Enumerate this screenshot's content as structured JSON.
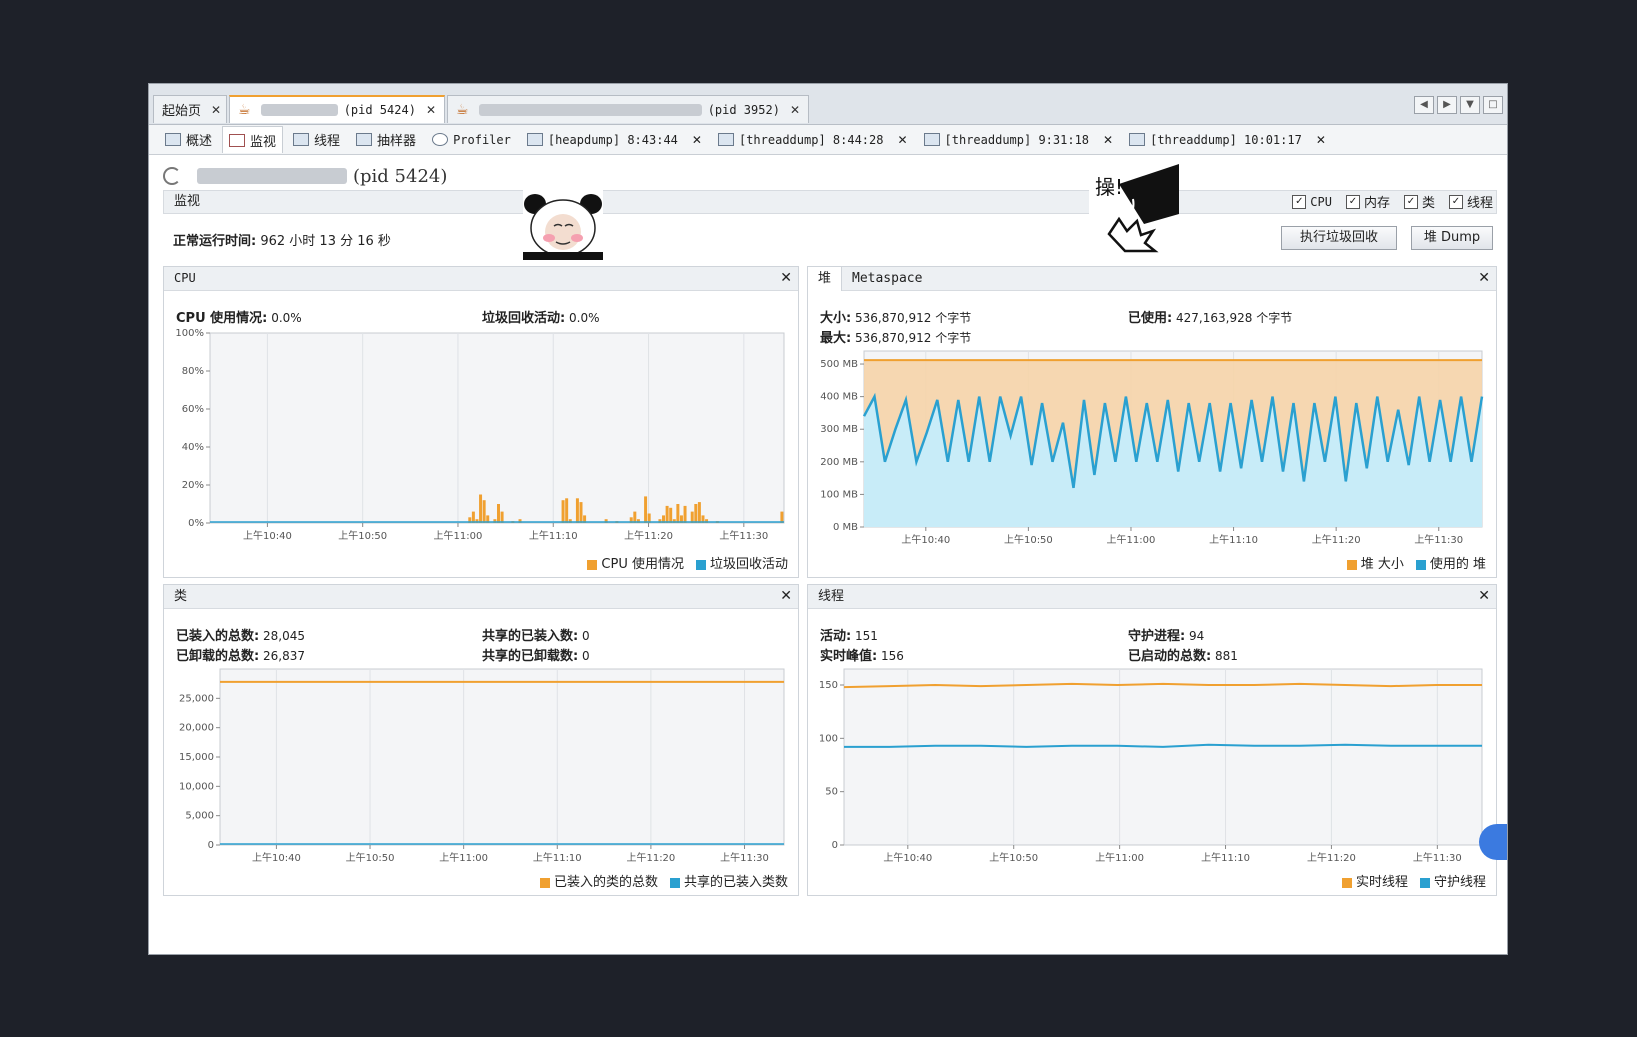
{
  "doc_tabs": [
    {
      "label": "起始页"
    },
    {
      "label": "(pid 5424)"
    },
    {
      "label": "(pid 3952)"
    }
  ],
  "sub_tabs": [
    {
      "label": "概述"
    },
    {
      "label": "监视"
    },
    {
      "label": "线程"
    },
    {
      "label": "抽样器"
    },
    {
      "label": "Profiler"
    },
    {
      "label": "[heapdump] 8:43:44"
    },
    {
      "label": "[threaddump] 8:44:28"
    },
    {
      "label": "[threaddump] 9:31:18"
    },
    {
      "label": "[threaddump] 10:01:17"
    }
  ],
  "process_title": "(pid 5424)",
  "monitor": {
    "section": "监视",
    "checkboxes": [
      "CPU",
      "内存",
      "类",
      "线程"
    ],
    "uptime_label": "正常运行时间:",
    "uptime_value": "962 小时 13 分 16 秒",
    "gc_button": "执行垃圾回收",
    "dump_button": "堆 Dump"
  },
  "stickers": {
    "text": "操!"
  },
  "cpu_panel": {
    "title": "CPU",
    "usage_label": "CPU 使用情况:",
    "usage_value": "0.0%",
    "gc_label": "垃圾回收活动:",
    "gc_value": "0.0%",
    "legend": [
      "CPU 使用情况",
      "垃圾回收活动"
    ]
  },
  "heap_panel": {
    "tabs": [
      "堆",
      "Metaspace"
    ],
    "size_label": "大小:",
    "size_value": "536,870,912 个字节",
    "max_label": "最大:",
    "max_value": "536,870,912 个字节",
    "used_label": "已使用:",
    "used_value": "427,163,928 个字节",
    "legend": [
      "堆 大小",
      "使用的 堆"
    ]
  },
  "classes_panel": {
    "title": "类",
    "loaded_label": "已装入的总数:",
    "loaded_value": "28,045",
    "unloaded_label": "已卸载的总数:",
    "unloaded_value": "26,837",
    "shared_loaded_label": "共享的已装入数:",
    "shared_loaded_value": "0",
    "shared_unloaded_label": "共享的已卸载数:",
    "shared_unloaded_value": "0",
    "legend": [
      "已装入的类的总数",
      "共享的已装入类数"
    ]
  },
  "threads_panel": {
    "title": "线程",
    "live_label": "活动:",
    "live_value": "151",
    "peak_label": "实时峰值:",
    "peak_value": "156",
    "daemon_label": "守护进程:",
    "daemon_value": "94",
    "started_label": "已启动的总数:",
    "started_value": "881",
    "legend": [
      "实时线程",
      "守护线程"
    ]
  },
  "colors": {
    "orange": "#f0a030",
    "blue": "#2aa0d0",
    "heap_fill": "#f6d4a8",
    "used_fill": "#c8ecf8"
  },
  "chart_data": [
    {
      "type": "bar",
      "title": "CPU",
      "x_ticks": [
        "上午10:40",
        "上午10:50",
        "上午11:00",
        "上午11:10",
        "上午11:20",
        "上午11:30"
      ],
      "y_ticks": [
        "100%",
        "80%",
        "60%",
        "40%",
        "20%",
        "0%"
      ],
      "ylim": [
        0,
        100
      ],
      "series": [
        {
          "name": "CPU 使用情况",
          "color": "#f0a030",
          "values": [
            0,
            0,
            0,
            0,
            0,
            0,
            0,
            0,
            0,
            0,
            0,
            0,
            0,
            0,
            0,
            0,
            0,
            0,
            0,
            0,
            0,
            0,
            0,
            0,
            0,
            0,
            0,
            0,
            0,
            0,
            0,
            0,
            0,
            0,
            0,
            0,
            0,
            0,
            0,
            0,
            0,
            0,
            0,
            0,
            0,
            0,
            0,
            0,
            0,
            0,
            0,
            0,
            0,
            0,
            0,
            0,
            0,
            0,
            0,
            0,
            0,
            0,
            0,
            0,
            0,
            0,
            0,
            0,
            0,
            0,
            0,
            0,
            3,
            6,
            2,
            15,
            12,
            4,
            0,
            2,
            10,
            6,
            0,
            0,
            1,
            0,
            2,
            0,
            0,
            0,
            0,
            0,
            0,
            0,
            0,
            0,
            0,
            0,
            12,
            13,
            2,
            0,
            13,
            11,
            4,
            0,
            0,
            0,
            0,
            0,
            2,
            0,
            0,
            1,
            0,
            0,
            0,
            3,
            6,
            2,
            0,
            14,
            5,
            0,
            0,
            2,
            4,
            9,
            8,
            2,
            10,
            4,
            9,
            0,
            6,
            10,
            11,
            4,
            2,
            0,
            0,
            1,
            0,
            0,
            0,
            0,
            0,
            0,
            0,
            0,
            0,
            0,
            0,
            0,
            0,
            0,
            0,
            0,
            0,
            6
          ]
        },
        {
          "name": "垃圾回收活动",
          "color": "#2aa0d0",
          "values": []
        }
      ]
    },
    {
      "type": "area",
      "title": "堆",
      "x_ticks": [
        "上午10:40",
        "上午10:50",
        "上午11:00",
        "上午11:10",
        "上午11:20",
        "上午11:30"
      ],
      "y_ticks": [
        "500 MB",
        "400 MB",
        "300 MB",
        "200 MB",
        "100 MB",
        "0 MB"
      ],
      "ylim": [
        0,
        540
      ],
      "series": [
        {
          "name": "堆 大小",
          "color": "#f0a030",
          "values_mb": [
            512,
            512
          ]
        },
        {
          "name": "使用的 堆",
          "color": "#2aa0d0",
          "values_mb": [
            340,
            400,
            200,
            300,
            390,
            200,
            290,
            390,
            200,
            390,
            200,
            400,
            200,
            400,
            280,
            400,
            190,
            380,
            200,
            320,
            120,
            390,
            160,
            380,
            200,
            400,
            200,
            380,
            200,
            390,
            170,
            380,
            200,
            380,
            170,
            380,
            180,
            390,
            200,
            400,
            170,
            380,
            140,
            380,
            200,
            400,
            140,
            380,
            180,
            400,
            200,
            360,
            190,
            400,
            200,
            390,
            200,
            400,
            200,
            400
          ]
        }
      ]
    },
    {
      "type": "line",
      "title": "类",
      "x_ticks": [
        "上午10:40",
        "上午10:50",
        "上午11:00",
        "上午11:10",
        "上午11:20",
        "上午11:30"
      ],
      "y_ticks": [
        "25,000",
        "20,000",
        "15,000",
        "10,000",
        "5,000",
        "0"
      ],
      "ylim": [
        0,
        30000
      ],
      "series": [
        {
          "name": "已装入的类的总数",
          "color": "#f0a030",
          "values": [
            27800,
            27800
          ]
        },
        {
          "name": "共享的已装入类数",
          "color": "#2aa0d0",
          "values": [
            0,
            0
          ]
        }
      ]
    },
    {
      "type": "line",
      "title": "线程",
      "x_ticks": [
        "上午10:40",
        "上午10:50",
        "上午11:00",
        "上午11:10",
        "上午11:20",
        "上午11:30"
      ],
      "y_ticks": [
        "150",
        "100",
        "50",
        "0"
      ],
      "ylim": [
        0,
        165
      ],
      "series": [
        {
          "name": "实时线程",
          "color": "#f0a030",
          "values": [
            148,
            149,
            150,
            149,
            150,
            151,
            150,
            151,
            150,
            150,
            151,
            150,
            149,
            150,
            150
          ]
        },
        {
          "name": "守护线程",
          "color": "#2aa0d0",
          "values": [
            92,
            92,
            93,
            93,
            92,
            93,
            93,
            92,
            94,
            93,
            93,
            94,
            93,
            93,
            93
          ]
        }
      ]
    }
  ]
}
